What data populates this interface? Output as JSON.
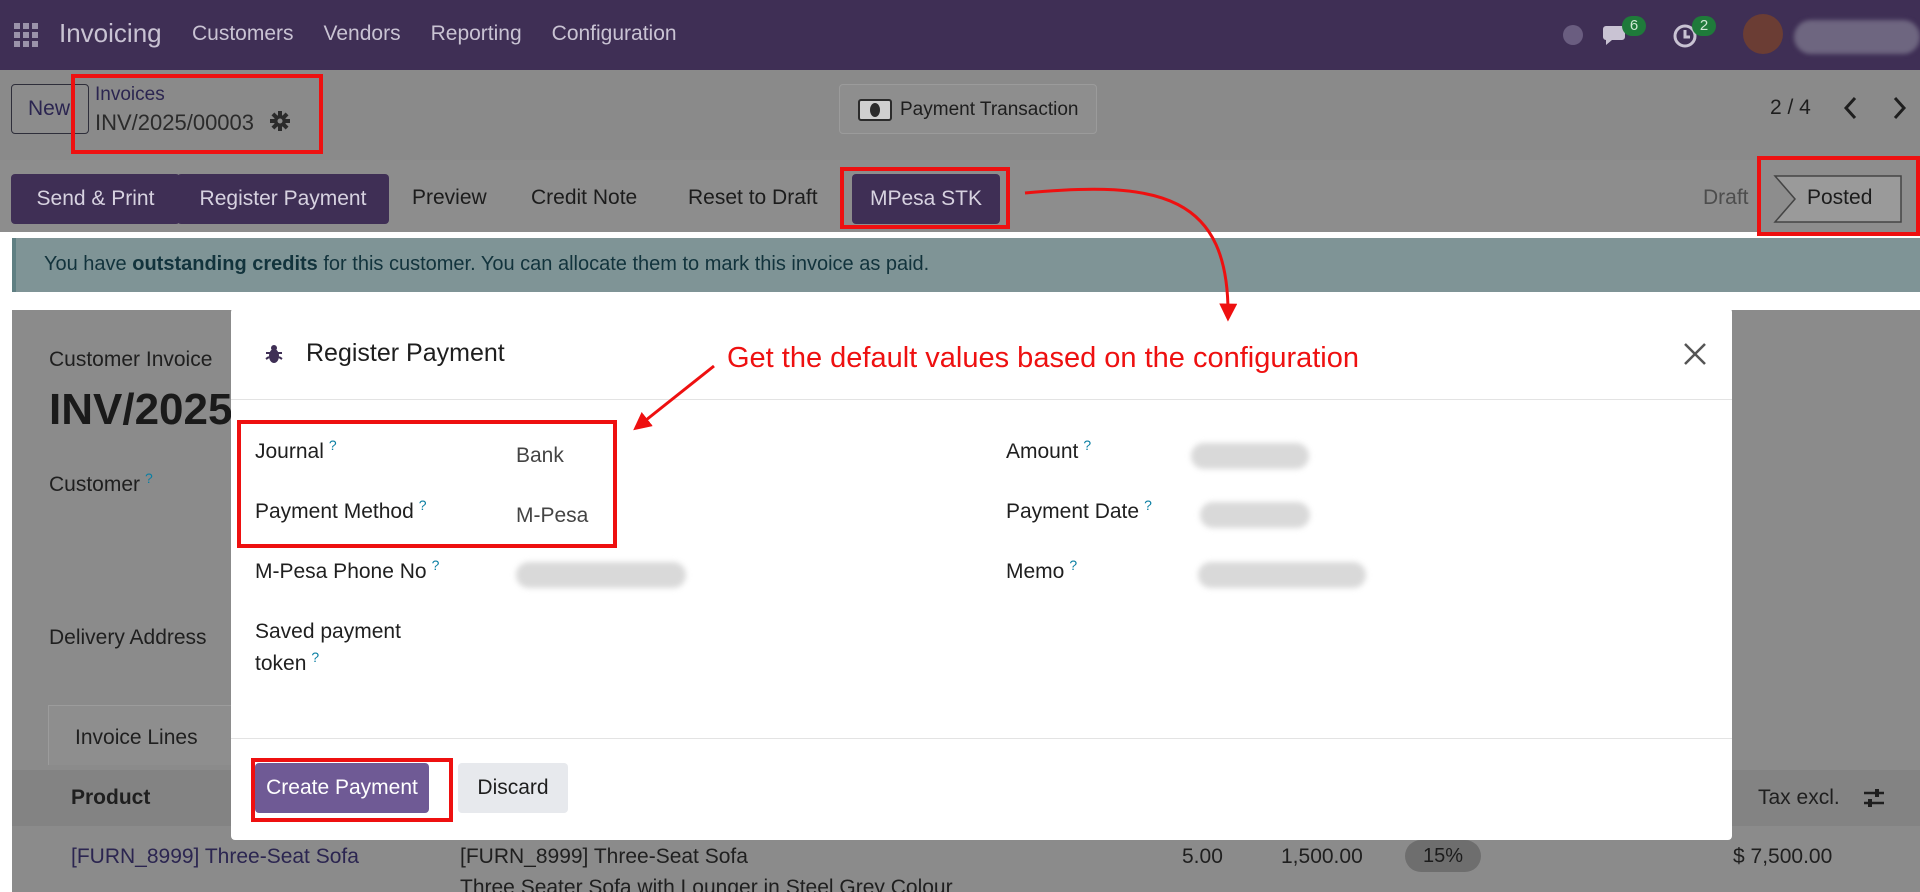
{
  "navbar": {
    "brand": "Invoicing",
    "menu": [
      "Customers",
      "Vendors",
      "Reporting",
      "Configuration"
    ],
    "messages_badge": "6",
    "activities_badge": "2"
  },
  "control_panel": {
    "new_label": "New",
    "breadcrumb_parent": "Invoices",
    "breadcrumb_current": "INV/2025/00003",
    "payment_transaction_label": "Payment Transaction",
    "pager": "2 / 4"
  },
  "actions": {
    "send_print": "Send & Print",
    "register_payment": "Register Payment",
    "preview": "Preview",
    "credit_note": "Credit Note",
    "reset_to_draft": "Reset to Draft",
    "mpesa_stk": "MPesa STK"
  },
  "status": {
    "draft": "Draft",
    "posted": "Posted"
  },
  "alert": {
    "prefix": "You have ",
    "strong": "outstanding credits",
    "suffix": " for this customer. You can allocate them to mark this invoice as paid."
  },
  "background": {
    "doc_type": "Customer Invoice",
    "doc_number": "INV/2025",
    "customer_label": "Customer",
    "delivery_label": "Delivery Address",
    "tab_label": "Invoice Lines",
    "col_product": "Product",
    "col_tax_excl": "Tax excl.",
    "line_product": "[FURN_8999] Three-Seat Sofa",
    "line_label": "[FURN_8999] Three-Seat Sofa",
    "line_desc": "Three Seater Sofa with Lounger in Steel Grey Colour",
    "line_qty": "5.00",
    "line_price": "1,500.00",
    "line_tax": "15%",
    "line_total": "$ 7,500.00"
  },
  "modal": {
    "title": "Register Payment",
    "journal_label": "Journal",
    "journal_value": "Bank",
    "payment_method_label": "Payment Method",
    "payment_method_value": "M-Pesa",
    "phone_label": "M-Pesa Phone No",
    "token_label_1": "Saved payment",
    "token_label_2": "token",
    "amount_label": "Amount",
    "payment_date_label": "Payment Date",
    "memo_label": "Memo",
    "help_mark": "?",
    "create_label": "Create Payment",
    "discard_label": "Discard"
  },
  "annotation": {
    "text": "Get the default values based on the configuration",
    "color": "#ee1010"
  },
  "colors": {
    "navbar": "#3f2f55",
    "primary": "#6f5a95",
    "help": "#0b7fa3"
  }
}
